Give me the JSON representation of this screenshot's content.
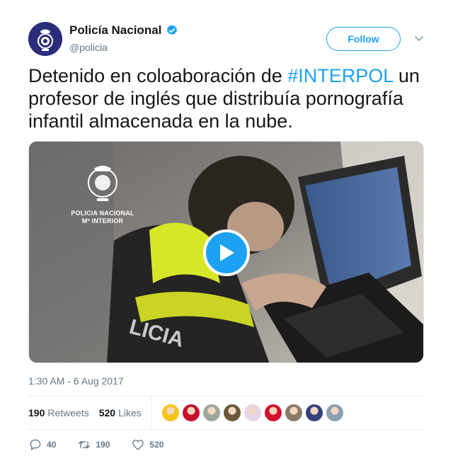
{
  "author": {
    "display_name": "Policía Nacional",
    "handle": "@policia",
    "verified": true
  },
  "follow_label": "Follow",
  "tweet": {
    "text_before": "Detenido en coloaboración de ",
    "hashtag": "#INTERPOL",
    "text_after": " un profesor de inglés que distribuía pornografía infantil almacenada en la nube."
  },
  "media": {
    "logo_line1": "POLICIA NACIONAL",
    "logo_line2": "Mº INTERIOR",
    "play_icon": "play-icon"
  },
  "timestamp": "1:30 AM - 6 Aug 2017",
  "stats": {
    "retweets_count": "190",
    "retweets_label": "Retweets",
    "likes_count": "520",
    "likes_label": "Likes"
  },
  "liker_avatars": [
    {
      "color": "#f5c518"
    },
    {
      "color": "#c8102e"
    },
    {
      "color": "#9aa89a"
    },
    {
      "color": "#6b5a3a"
    },
    {
      "color": "#e8d4e8"
    },
    {
      "color": "#d0122c"
    },
    {
      "color": "#8a7a6a"
    },
    {
      "color": "#33417a"
    },
    {
      "color": "#8aa0b0"
    }
  ],
  "actions": {
    "reply_count": "40",
    "retweet_count": "190",
    "like_count": "520"
  },
  "colors": {
    "accent": "#1da1f2",
    "text": "#14171a",
    "secondary": "#657786"
  }
}
